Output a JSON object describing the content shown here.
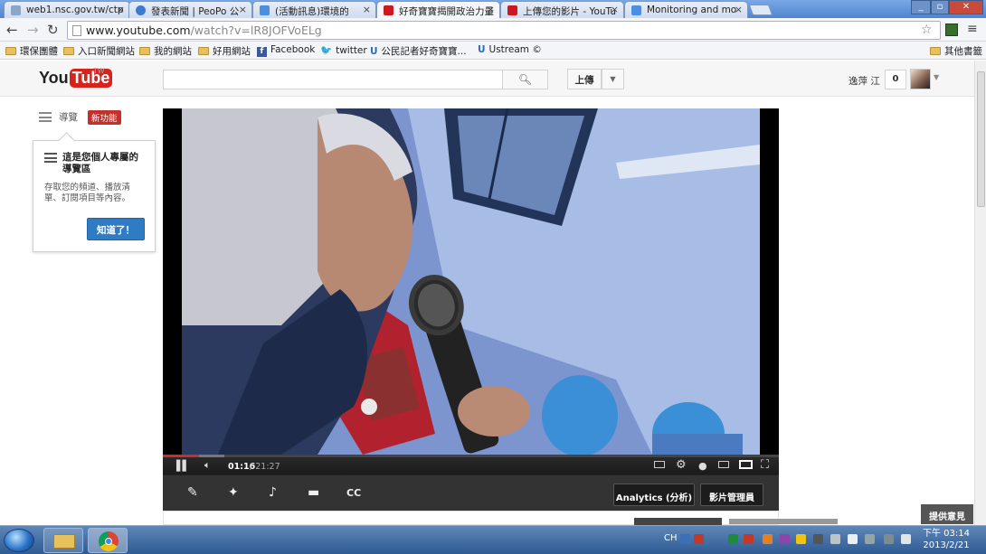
{
  "browser": {
    "tabs": [
      {
        "label": "web1.nsc.gov.tw/ctp",
        "color": "#8da6c8"
      },
      {
        "label": "發表新聞 | PeoPo 公",
        "color": "#3b7bd0"
      },
      {
        "label": "(活動訊息)環境的",
        "color": "#4c8ee0"
      },
      {
        "label": "好奇寶寶揭開政治力量",
        "color": "#cc181e"
      },
      {
        "label": "上傳您的影片 - YouTu",
        "color": "#cc181e"
      },
      {
        "label": "Monitoring and mo",
        "color": "#4c8ee0"
      }
    ],
    "tab_close": "×",
    "url_domain": "www.youtube.com",
    "url_path": "/watch?v=lR8JOFVoELg",
    "bookmarks": [
      {
        "label": "環保團體",
        "icon": "folder-icon"
      },
      {
        "label": "入口新聞網站",
        "icon": "folder-icon"
      },
      {
        "label": "我的網站",
        "icon": "folder-icon"
      },
      {
        "label": "好用網站",
        "icon": "folder-icon"
      },
      {
        "label": "Facebook",
        "icon": "facebook-icon"
      },
      {
        "label": "twitter",
        "icon": "twitter-icon"
      },
      {
        "label": "公民記者好奇寶寶...",
        "icon": "ustream-icon"
      },
      {
        "label": "Ustream ©",
        "icon": "ustream-icon"
      }
    ],
    "other_bookmarks": "其他書籤"
  },
  "youtube": {
    "logo_you": "You",
    "logo_tube": "Tube",
    "logo_region": "TW",
    "search_placeholder": "",
    "upload_label": "上傳",
    "user_name": "逸萍 江",
    "notification_count": "0",
    "guide_label": "導覽",
    "new_badge": "新功能",
    "guide_popup": {
      "title": "這是您個人專屬的導覽區",
      "body": "存取您的頻道、播放清單、訂閱項目等內容。",
      "button": "知道了！"
    },
    "player": {
      "current_time": "01:16",
      "separator": "/",
      "total_time": "21:27",
      "progress": 0.059,
      "buffered": 0.1
    },
    "actions": {
      "analytics": "Analytics (分析)",
      "video_manager": "影片管理員"
    },
    "feedback": "提供意見"
  },
  "taskbar": {
    "language": "CH",
    "time": "下午 03:14",
    "date": "2013/2/21"
  },
  "colors": {
    "youtube_red": "#c4302b",
    "button_blue": "#2f7cc4",
    "taskbar": "#2f5b93"
  }
}
